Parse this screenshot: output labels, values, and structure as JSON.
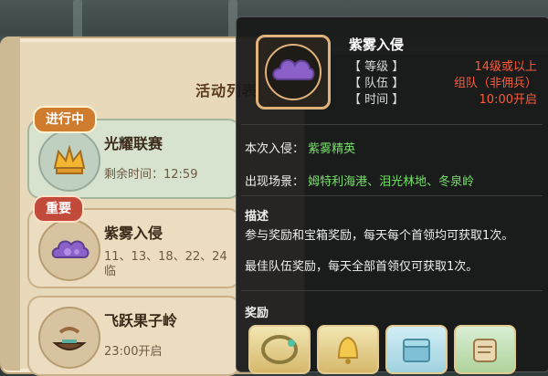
{
  "left_panel": {
    "title": "活动列表",
    "cards": [
      {
        "badge": "进行中",
        "title": "光耀联赛",
        "sub": "剩余时间：12:59",
        "sub2": ""
      },
      {
        "badge": "重要",
        "title": "紫雾入侵",
        "sub": "11、13、18、22、24",
        "sub2": "临"
      },
      {
        "badge": "",
        "title": "飞跃果子岭",
        "sub": "23:00开启",
        "sub2": ""
      }
    ]
  },
  "tooltip": {
    "name": "紫雾入侵",
    "rows": [
      {
        "label": "【 等级 】",
        "value": "14级或以上"
      },
      {
        "label": "【 队伍 】",
        "value": "组队（非佣兵）"
      },
      {
        "label": "【 时间 】",
        "value": "10:00开启"
      }
    ],
    "current_label": "本次入侵：",
    "current_value": "紫雾精英",
    "scene_label": "出现场景：",
    "scene_value": "姆特利海港、泪光林地、冬泉岭",
    "desc_title": "描述",
    "desc_lines": [
      "参与奖励和宝箱奖励，每天每个首领均可获取1次。",
      "最佳队伍奖励，每天全部首领仅可获取1次。"
    ],
    "reward_title": "奖励"
  },
  "colors": {
    "accent_red": "#ff5a3a",
    "accent_green": "#78e06a"
  },
  "icons": [
    "crown-icon",
    "cloud-icon",
    "boat-icon",
    "ring-icon",
    "bell-icon",
    "chest-icon",
    "scroll-icon"
  ]
}
